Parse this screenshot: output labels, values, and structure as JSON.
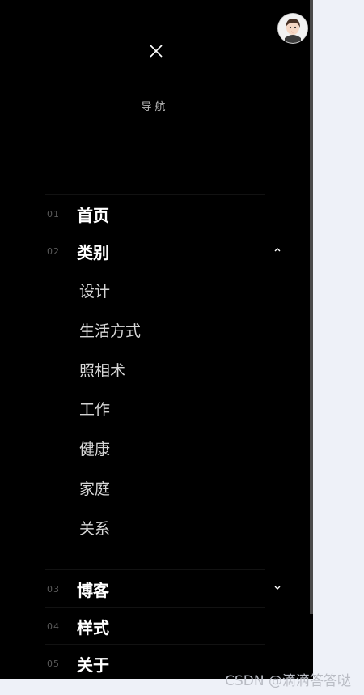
{
  "drawer": {
    "heading": "导航",
    "close_icon": "close-icon",
    "avatar_icon": "avatar"
  },
  "nav": {
    "items": [
      {
        "num": "01",
        "label": "首页"
      },
      {
        "num": "02",
        "label": "类别",
        "expanded": true,
        "chevron": "chevron-up-icon"
      },
      {
        "num": "03",
        "label": "博客",
        "expanded": false,
        "chevron": "chevron-down-icon"
      },
      {
        "num": "04",
        "label": "样式"
      },
      {
        "num": "05",
        "label": "关于"
      }
    ],
    "category_submenu": [
      "设计",
      "生活方式",
      "照相术",
      "工作",
      "健康",
      "家庭",
      "关系"
    ]
  },
  "watermark": "CSDN @滴滴答答哒",
  "colors": {
    "drawer_bg": "#000000",
    "page_bg": "#eef1f8",
    "primary_text": "#ffffff",
    "sub_text": "#d6d6d6",
    "muted_text": "#5b5b5b"
  }
}
